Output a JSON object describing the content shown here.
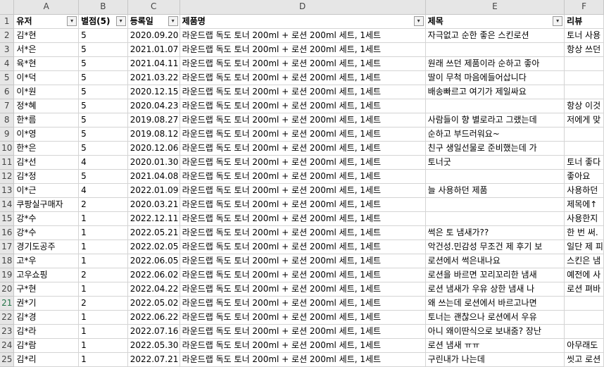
{
  "columns": [
    "A",
    "B",
    "C",
    "D",
    "E",
    "F"
  ],
  "headers": [
    {
      "label": "유저",
      "filter": true
    },
    {
      "label": "별점(5)",
      "filter": true
    },
    {
      "label": "등록일",
      "filter": true
    },
    {
      "label": "제품명",
      "filter": true
    },
    {
      "label": "제목",
      "filter": true
    },
    {
      "label": "리뷰",
      "filter": false
    }
  ],
  "header_row_number": "1",
  "rows": [
    {
      "n": "2",
      "c": [
        "김*현",
        "5",
        "2020.09.20",
        "라운드랩 독도 토너 200ml + 로션 200ml 세트, 1세트",
        "자극없고 순한 좋은 스킨로션",
        "토너 사용"
      ]
    },
    {
      "n": "3",
      "c": [
        "서*은",
        "5",
        "2021.01.07",
        "라운드랩 독도 토너 200ml + 로션 200ml 세트, 1세트",
        "",
        "항상 쓰던"
      ]
    },
    {
      "n": "4",
      "c": [
        "육*현",
        "5",
        "2021.04.11",
        "라운드랩 독도 토너 200ml + 로션 200ml 세트, 1세트",
        "원래 쓰던 제품이라 순하고 좋아",
        ""
      ]
    },
    {
      "n": "5",
      "c": [
        "이*덕",
        "5",
        "2021.03.22",
        "라운드랩 독도 토너 200ml + 로션 200ml 세트, 1세트",
        "딸이 무척 마음에들어삽니다",
        ""
      ]
    },
    {
      "n": "6",
      "c": [
        "이*원",
        "5",
        "2020.12.15",
        "라운드랩 독도 토너 200ml + 로션 200ml 세트, 1세트",
        "배송빠르고 여기가 제일싸요",
        ""
      ]
    },
    {
      "n": "7",
      "c": [
        "정*혜",
        "5",
        "2020.04.23",
        "라운드랩 독도 토너 200ml + 로션 200ml 세트, 1세트",
        "",
        "항상 이것"
      ]
    },
    {
      "n": "8",
      "c": [
        "한*름",
        "5",
        "2019.08.27",
        "라운드랩 독도 토너 200ml + 로션 200ml 세트, 1세트",
        "사람들이 향 별로라고 그랬는데",
        "저에게 맞"
      ]
    },
    {
      "n": "9",
      "c": [
        "이*영",
        "5",
        "2019.08.12",
        "라운드랩 독도 토너 200ml + 로션 200ml 세트, 1세트",
        "순하고 부드러워요~",
        ""
      ]
    },
    {
      "n": "10",
      "c": [
        "한*은",
        "5",
        "2020.12.06",
        "라운드랩 독도 토너 200ml + 로션 200ml 세트, 1세트",
        "친구 생일선물로 준비했는데 가",
        ""
      ]
    },
    {
      "n": "11",
      "c": [
        "김*선",
        "4",
        "2020.01.30",
        "라운드랩 독도 토너 200ml + 로션 200ml 세트, 1세트",
        "토너굿",
        "토너 좋다"
      ]
    },
    {
      "n": "12",
      "c": [
        "김*정",
        "5",
        "2021.04.08",
        "라운드랩 독도 토너 200ml + 로션 200ml 세트, 1세트",
        "",
        "좋아요"
      ]
    },
    {
      "n": "13",
      "c": [
        "이*근",
        "4",
        "2022.01.09",
        "라운드랩 독도 토너 200ml + 로션 200ml 세트, 1세트",
        "늘 사용하던 제품",
        "사용하던"
      ]
    },
    {
      "n": "14",
      "c": [
        "쿠팡실구매자",
        "2",
        "2020.03.21",
        "라운드랩 독도 토너 200ml + 로션 200ml 세트, 1세트",
        "",
        "제목에↑"
      ]
    },
    {
      "n": "15",
      "c": [
        "강*수",
        "1",
        "2022.12.11",
        "라운드랩 독도 토너 200ml + 로션 200ml 세트, 1세트",
        "",
        "사용한지"
      ]
    },
    {
      "n": "16",
      "c": [
        "강*수",
        "1",
        "2022.05.21",
        "라운드랩 독도 토너 200ml + 로션 200ml 세트, 1세트",
        "썩은 토 냄새가??",
        "한 번 써."
      ]
    },
    {
      "n": "17",
      "c": [
        "경기도공주",
        "1",
        "2022.02.05",
        "라운드랩 독도 토너 200ml + 로션 200ml 세트, 1세트",
        "악건성.민감성 무조건 제 후기 보",
        "일단 제 피"
      ]
    },
    {
      "n": "18",
      "c": [
        "고*우",
        "1",
        "2022.06.05",
        "라운드랩 독도 토너 200ml + 로션 200ml 세트, 1세트",
        "로션에서 썩은내나요",
        "스킨은 냄"
      ]
    },
    {
      "n": "19",
      "c": [
        "고우쇼핑",
        "2",
        "2022.06.02",
        "라운드랩 독도 토너 200ml + 로션 200ml 세트, 1세트",
        "로션을 바르면 꼬리꼬리한 냄새",
        "예전에 사"
      ]
    },
    {
      "n": "20",
      "c": [
        "구*현",
        "1",
        "2022.04.22",
        "라운드랩 독도 토너 200ml + 로션 200ml 세트, 1세트",
        "로션 냄새가 우유 상한 냄새 나",
        "로션 펴바"
      ]
    },
    {
      "n": "21",
      "c": [
        "권*기",
        "2",
        "2022.05.02",
        "라운드랩 독도 토너 200ml + 로션 200ml 세트, 1세트",
        "왜 쓰는데 로션에서 바르고나면",
        ""
      ]
    },
    {
      "n": "22",
      "c": [
        "김*경",
        "1",
        "2022.06.22",
        "라운드랩 독도 토너 200ml + 로션 200ml 세트, 1세트",
        "토너는 괜찮으나 로션에서 우유",
        ""
      ]
    },
    {
      "n": "23",
      "c": [
        "김*라",
        "1",
        "2022.07.16",
        "라운드랩 독도 토너 200ml + 로션 200ml 세트, 1세트",
        "아니 왜이딴식으로 보내줌? 장난",
        ""
      ]
    },
    {
      "n": "24",
      "c": [
        "김*람",
        "1",
        "2022.05.30",
        "라운드랩 독도 토너 200ml + 로션 200ml 세트, 1세트",
        "로션 냄새 ㅠㅠ",
        "아무래도"
      ]
    },
    {
      "n": "25",
      "c": [
        "김*리",
        "1",
        "2022.07.21",
        "라운드랩 독도 토너 200ml + 로션 200ml 세트, 1세트",
        "구린내가 나는데",
        "씻고 로션"
      ]
    }
  ],
  "filter_icon": "▾",
  "selected_row": "21"
}
